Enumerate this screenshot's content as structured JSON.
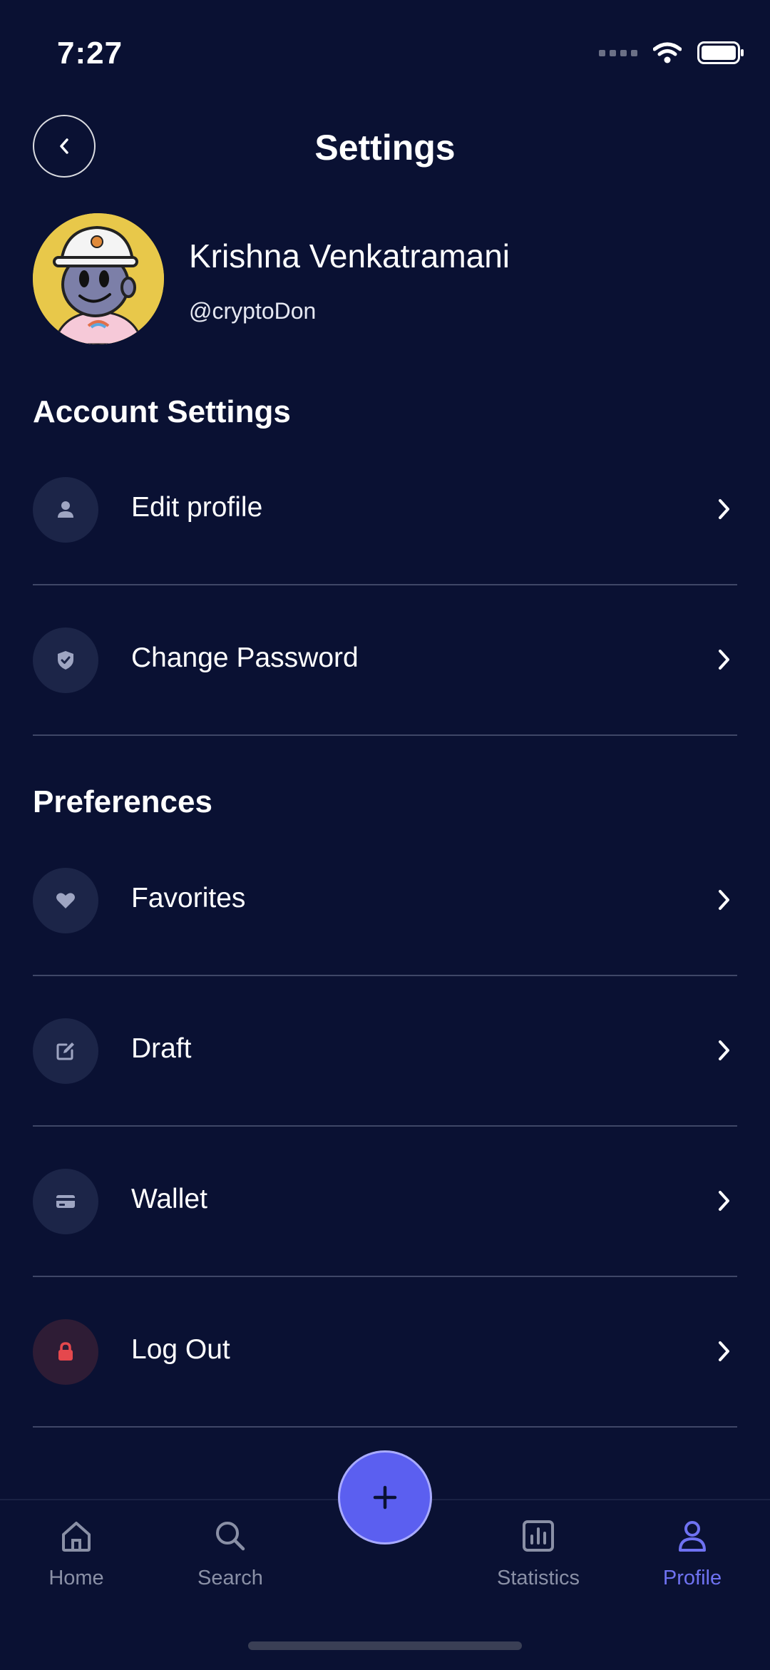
{
  "status_bar": {
    "time": "7:27"
  },
  "header": {
    "title": "Settings"
  },
  "profile": {
    "name": "Krishna Venkatramani",
    "handle": "@cryptoDon"
  },
  "sections": {
    "account": {
      "title": "Account Settings",
      "items": [
        {
          "label": "Edit profile",
          "icon": "person-icon"
        },
        {
          "label": "Change Password",
          "icon": "shield-icon"
        }
      ]
    },
    "preferences": {
      "title": "Preferences",
      "items": [
        {
          "label": "Favorites",
          "icon": "heart-icon"
        },
        {
          "label": "Draft",
          "icon": "edit-icon"
        },
        {
          "label": "Wallet",
          "icon": "card-icon"
        },
        {
          "label": "Log Out",
          "icon": "lock-icon"
        }
      ]
    }
  },
  "bottom_nav": {
    "items": [
      {
        "label": "Home",
        "icon": "home-icon"
      },
      {
        "label": "Search",
        "icon": "search-icon"
      },
      {
        "label": "Statistics",
        "icon": "statistics-icon"
      },
      {
        "label": "Profile",
        "icon": "profile-icon",
        "active": true
      }
    ],
    "fab_icon": "plus-icon"
  },
  "colors": {
    "background": "#0a1133",
    "accent": "#5b5ff0",
    "active_nav": "#6f72f2",
    "danger": "#e5484d",
    "icon_circle": "#1c2548"
  }
}
